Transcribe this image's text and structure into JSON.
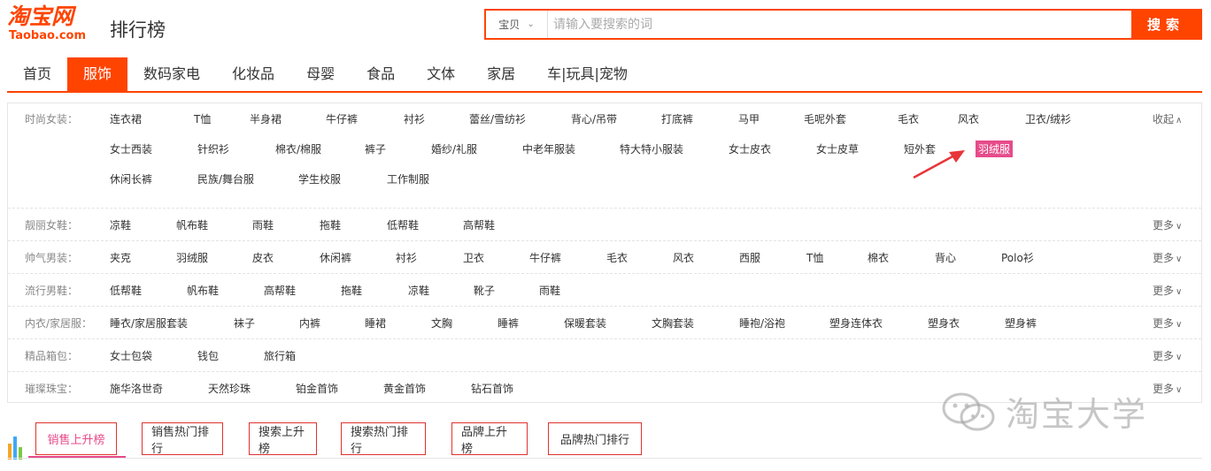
{
  "header": {
    "logo_cn": "淘宝网",
    "logo_en": "Taobao.com",
    "page_title": "排行榜",
    "search_type": "宝贝",
    "search_placeholder": "请输入要搜索的词",
    "search_button": "搜索"
  },
  "nav": {
    "items": [
      "首页",
      "服饰",
      "数码家电",
      "化妆品",
      "母婴",
      "食品",
      "文体",
      "家居",
      "车|玩具|宠物"
    ],
    "active_index": 1
  },
  "categories": {
    "rows": [
      {
        "label": "时尚女装：",
        "more": "收起",
        "items": [
          [
            "连衣裙",
            "T恤",
            "半身裙",
            "牛仔裤",
            "衬衫",
            "蕾丝/雪纺衫",
            "背心/吊带",
            "打底裤",
            "马甲",
            "毛呢外套",
            "毛衣",
            "风衣",
            "卫衣/绒衫"
          ],
          [
            "女士西装",
            "针织衫",
            "棉衣/棉服",
            "裤子",
            "婚纱/礼服",
            "中老年服装",
            "特大特小服装",
            "女士皮衣",
            "女士皮草",
            "短外套",
            "羽绒服"
          ],
          [
            "休闲长裤",
            "民族/舞台服",
            "学生校服",
            "工作制服"
          ]
        ]
      },
      {
        "label": "靓丽女鞋：",
        "more": "更多",
        "items": [
          [
            "凉鞋",
            "帆布鞋",
            "雨鞋",
            "拖鞋",
            "低帮鞋",
            "高帮鞋"
          ]
        ]
      },
      {
        "label": "帅气男装：",
        "more": "更多",
        "items": [
          [
            "夹克",
            "羽绒服",
            "皮衣",
            "休闲裤",
            "衬衫",
            "卫衣",
            "牛仔裤",
            "毛衣",
            "风衣",
            "西服",
            "T恤",
            "棉衣",
            "背心",
            "Polo衫"
          ]
        ]
      },
      {
        "label": "流行男鞋：",
        "more": "更多",
        "items": [
          [
            "低帮鞋",
            "帆布鞋",
            "高帮鞋",
            "拖鞋",
            "凉鞋",
            "靴子",
            "雨鞋"
          ]
        ]
      },
      {
        "label": "内衣/家居服：",
        "more": "更多",
        "items": [
          [
            "睡衣/家居服套装",
            "袜子",
            "内裤",
            "睡裙",
            "文胸",
            "睡裤",
            "保暖套装",
            "文胸套装",
            "睡袍/浴袍",
            "塑身连体衣",
            "塑身衣",
            "塑身裤"
          ]
        ]
      },
      {
        "label": "精品箱包：",
        "more": "更多",
        "items": [
          [
            "女士包袋",
            "钱包",
            "旅行箱"
          ]
        ]
      },
      {
        "label": "璀璨珠宝：",
        "more": "更多",
        "items": [
          [
            "施华洛世奇",
            "天然珍珠",
            "铂金首饰",
            "黄金首饰",
            "钻石首饰"
          ]
        ]
      }
    ],
    "highlighted": "羽绒服"
  },
  "watermark": "淘宝大学",
  "bottom_tabs": {
    "items": [
      "销售上升榜",
      "销售热门排行",
      "搜索上升榜",
      "搜索热门排行",
      "品牌上升榜",
      "品牌热门排行"
    ],
    "active_index": 0
  },
  "colors": {
    "brand": "#ff4400",
    "highlight": "#e64b8a",
    "tab_border": "#e0332f"
  }
}
